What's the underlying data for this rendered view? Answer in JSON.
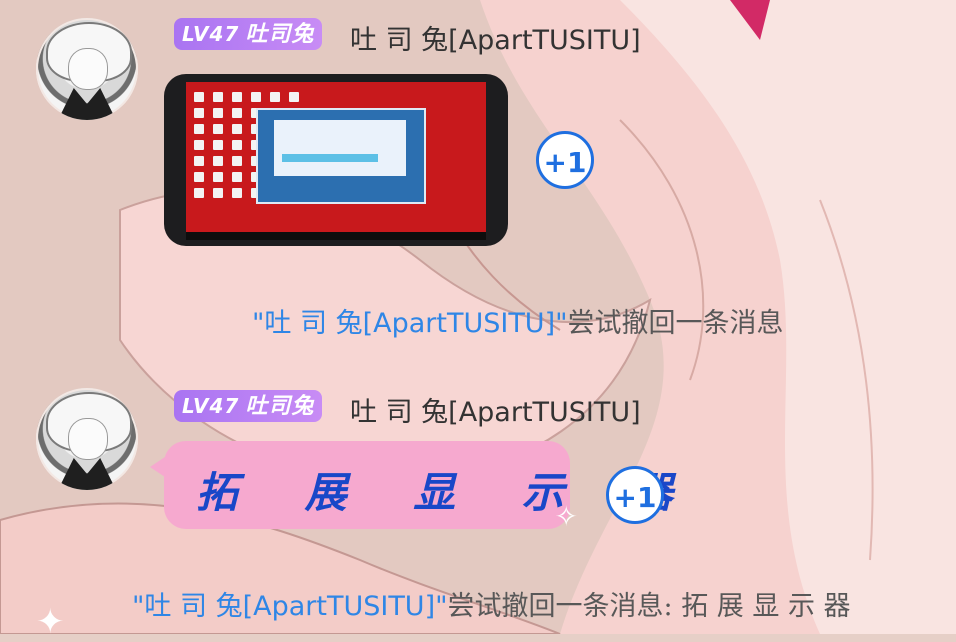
{
  "messages": [
    {
      "sender": {
        "level": "LV47",
        "title": "吐司兔",
        "nickname": "吐 司 兔[ApartTUSITU]"
      },
      "type": "image",
      "plus_one": "+1"
    },
    {
      "type": "system",
      "name": "\"吐 司 兔[ApartTUSITU]\"",
      "text": "尝试撤回一条消息"
    },
    {
      "sender": {
        "level": "LV47",
        "title": "吐司兔",
        "nickname": "吐 司 兔[ApartTUSITU]"
      },
      "type": "text",
      "text": "拓 展 显 示 器",
      "plus_one": "+1"
    },
    {
      "type": "system",
      "name": "\"吐 司 兔[ApartTUSITU]\"",
      "text": "尝试撤回一条消息: 拓 展 显 示 器"
    }
  ],
  "colors": {
    "badge_gradient_start": "#a974f2",
    "badge_gradient_end": "#c88cf5",
    "bubble_pink": "#f6a9cf",
    "bubble_text": "#1947c8",
    "plus_one_blue": "#1f6fe0",
    "system_name_blue": "#2f86e6"
  },
  "icons": [
    "user-avatar-icon",
    "plus-one-icon",
    "sparkle-icon"
  ]
}
